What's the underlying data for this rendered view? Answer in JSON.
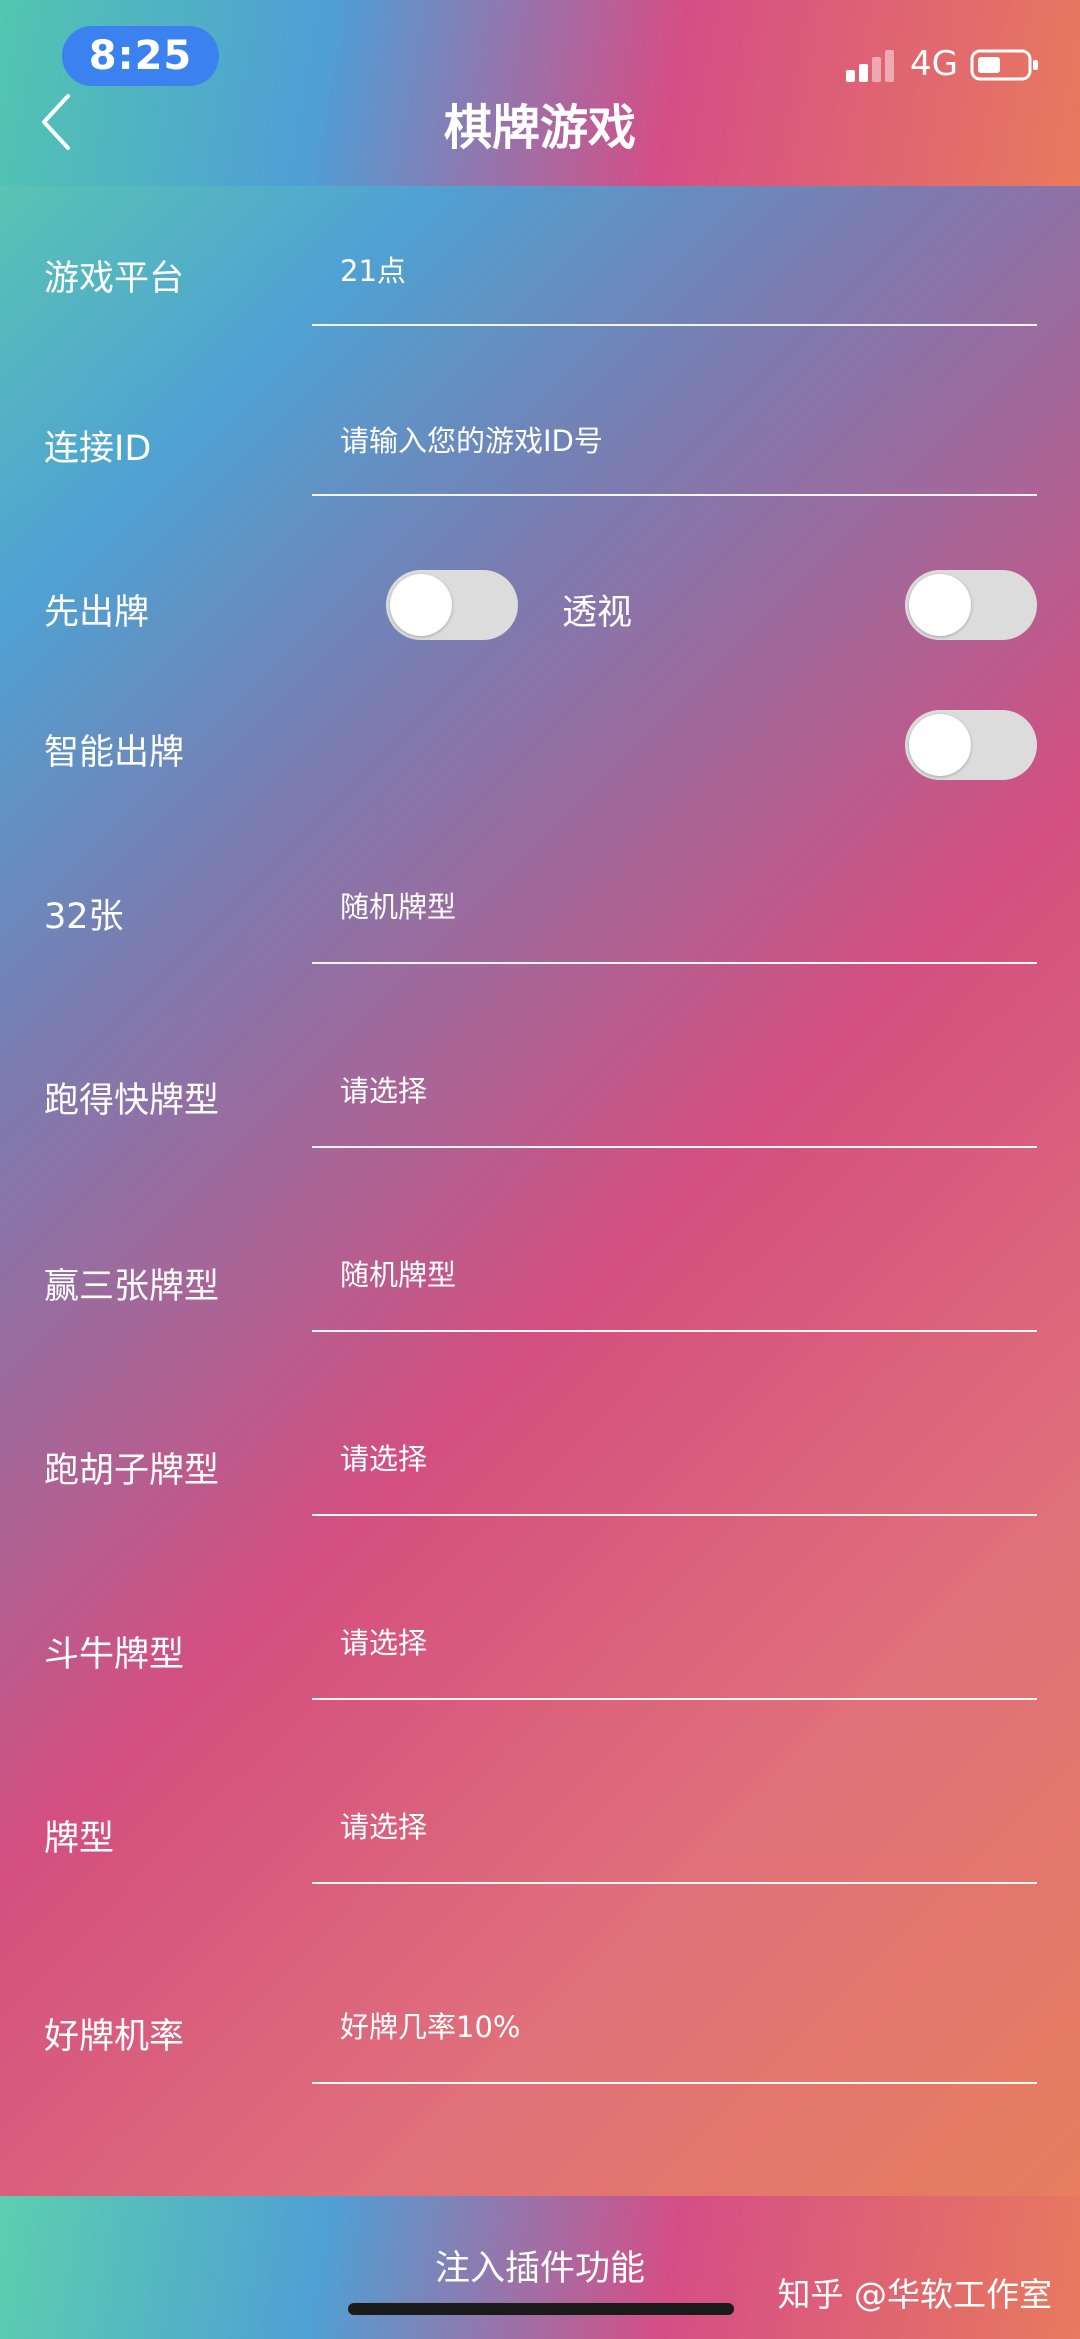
{
  "status_bar": {
    "time": "8:25",
    "network": "4G"
  },
  "header": {
    "title": "棋牌游戏"
  },
  "form": {
    "platform": {
      "label": "游戏平台",
      "value": "21点"
    },
    "connect_id": {
      "label": "连接ID",
      "placeholder": "请输入您的游戏ID号"
    },
    "first_card": {
      "label": "先出牌",
      "on": false
    },
    "see_through": {
      "label": "透视",
      "on": false
    },
    "smart_play": {
      "label": "智能出牌",
      "on": false
    },
    "cards32": {
      "label": "32张",
      "value": "随机牌型"
    },
    "pdk": {
      "label": "跑得快牌型",
      "value": "请选择"
    },
    "zjh": {
      "label": "赢三张牌型",
      "value": "随机牌型"
    },
    "phz": {
      "label": "跑胡子牌型",
      "value": "请选择"
    },
    "niuniu": {
      "label": "斗牛牌型",
      "value": "请选择"
    },
    "card_type": {
      "label": "牌型",
      "value": "请选择"
    },
    "good_rate": {
      "label": "好牌机率",
      "value": "好牌几率10%"
    }
  },
  "footer": {
    "submit_label": "注入插件功能",
    "watermark": "知乎 @华软工作室"
  }
}
